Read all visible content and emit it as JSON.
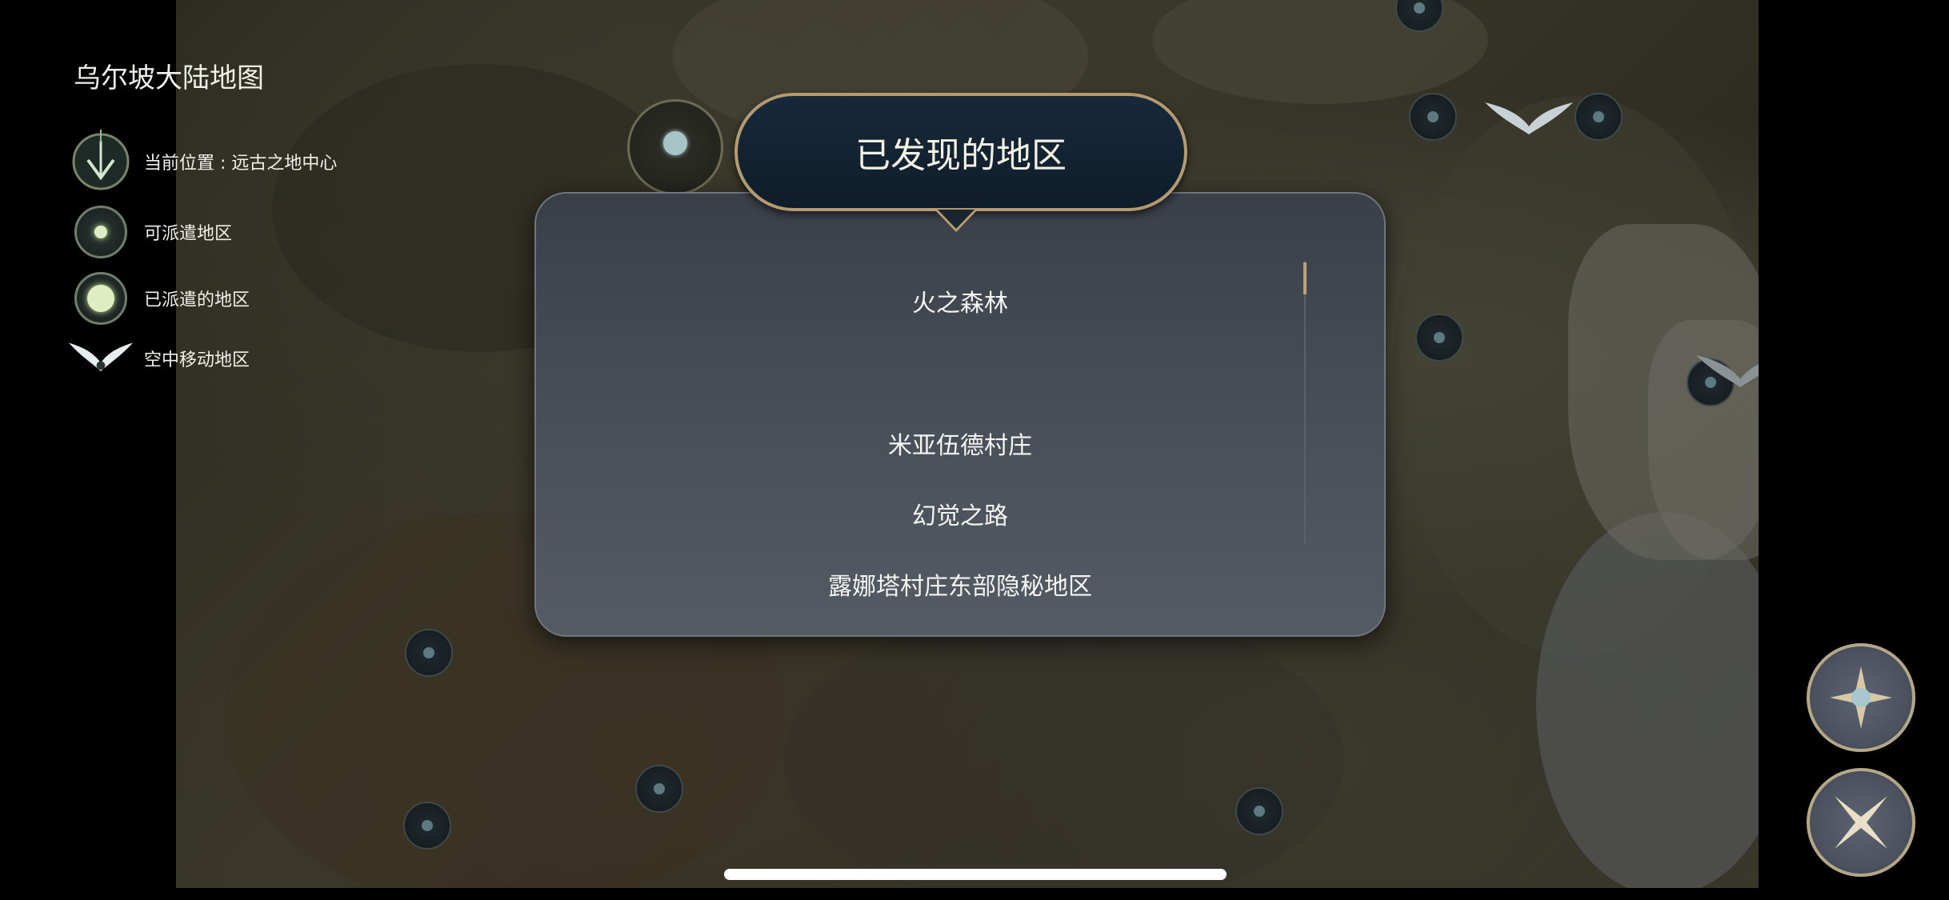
{
  "map": {
    "title": "乌尔坡大陆地图"
  },
  "legend": [
    {
      "icon": "current-location-arrow-icon",
      "label": "当前位置 : 远古之地中心"
    },
    {
      "icon": "dispatchable-region-icon",
      "label": "可派遣地区"
    },
    {
      "icon": "dispatched-region-icon",
      "label": "已派遣的地区"
    },
    {
      "icon": "wing-icon",
      "label": "空中移动地区"
    }
  ],
  "dialog": {
    "title": "已发现的地区",
    "regions": [
      "火之森林",
      "米亚伍德村庄",
      "幻觉之路",
      "露娜塔村庄东部隐秘地区"
    ]
  },
  "buttons": {
    "locate": {
      "icon": "compass-star-icon"
    },
    "close": {
      "icon": "close-star-icon"
    }
  },
  "colors": {
    "accent_gold": "#b49a70",
    "header_bg": "#17293a",
    "dialog_bg": "#4a5059",
    "dot_green": "#dfeec2"
  }
}
